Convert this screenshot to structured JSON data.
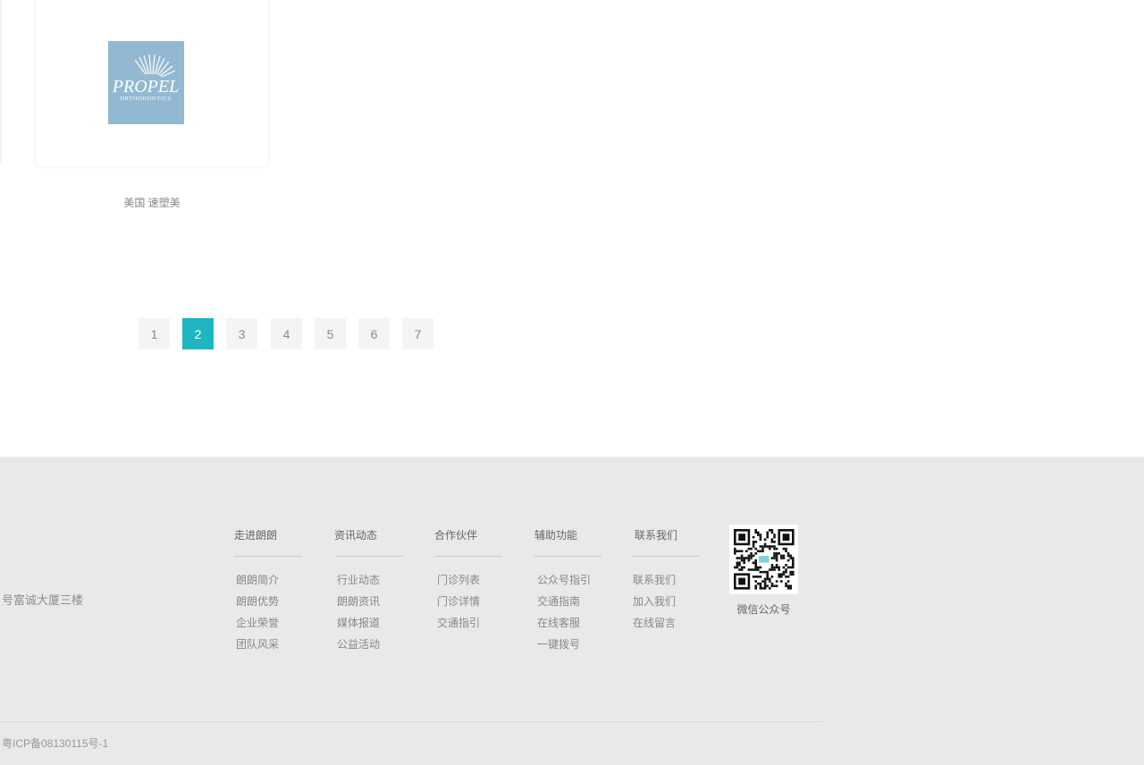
{
  "partner": {
    "logo_text": "PROPEL",
    "logo_subtext": "ORTHODONTICS",
    "caption": "美国 速塑美"
  },
  "pagination": {
    "pages": [
      "1",
      "2",
      "3",
      "4",
      "5",
      "6",
      "7"
    ],
    "current": "2",
    "active_color": "#1fb5c2"
  },
  "footer": {
    "address_fragment": "号富诚大厦三楼",
    "columns": [
      {
        "title": "走进朗朗",
        "links": [
          "朗朗简介",
          "朗朗优势",
          "企业荣誉",
          "团队风采"
        ]
      },
      {
        "title": "资讯动态",
        "links": [
          "行业动态",
          "朗朗资讯",
          "媒体报道",
          "公益活动"
        ]
      },
      {
        "title": "合作伙伴",
        "links": [
          "门诊列表",
          "门诊详情",
          "交通指引"
        ]
      },
      {
        "title": "辅助功能",
        "links": [
          "公众号指引",
          "交通指南",
          "在线客服",
          "一键拨号"
        ]
      },
      {
        "title": "联系我们",
        "links": [
          "联系我们",
          "加入我们",
          "在线留言"
        ]
      }
    ],
    "qr_caption": "微信公众号",
    "icp": "粤ICP备08130115号-1"
  },
  "colors": {
    "footer_bg": "#e9e9e9",
    "logo_bg": "#93b9d2"
  }
}
